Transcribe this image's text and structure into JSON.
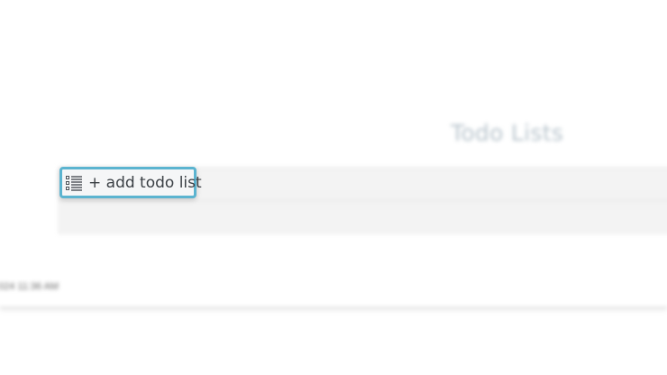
{
  "header": {
    "title": "Todo Lists"
  },
  "todo_panel": {
    "add_button_label": "+ add todo list",
    "add_button_icon": "list-icon",
    "highlight_color": "#5bb4d0"
  },
  "footer": {
    "timestamp": "024 11:36 AM"
  }
}
